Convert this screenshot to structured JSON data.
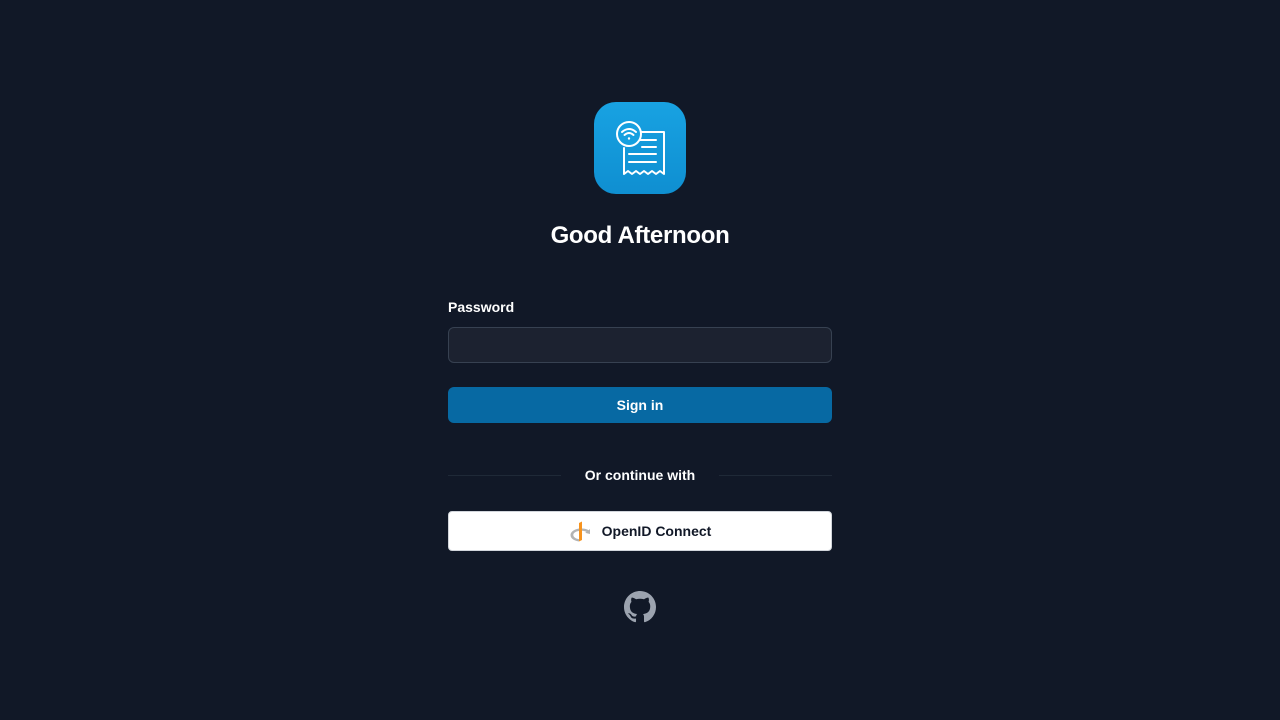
{
  "login": {
    "title": "Good Afternoon",
    "password_label": "Password",
    "password_value": "",
    "password_placeholder": "",
    "signin_label": "Sign in",
    "divider_text": "Or continue with",
    "oidc_label": "OpenID Connect"
  },
  "icons": {
    "app_logo": "receipt-wifi-icon",
    "oidc": "openid-icon",
    "footer": "github-icon"
  },
  "colors": {
    "background": "#111827",
    "logo_bg": "#18a2e2",
    "primary_button": "#0769a3",
    "oidc_button_bg": "#ffffff",
    "openid_orange": "#f7931e",
    "openid_gray": "#b3b3b3",
    "github_gray": "#9ca3af"
  }
}
